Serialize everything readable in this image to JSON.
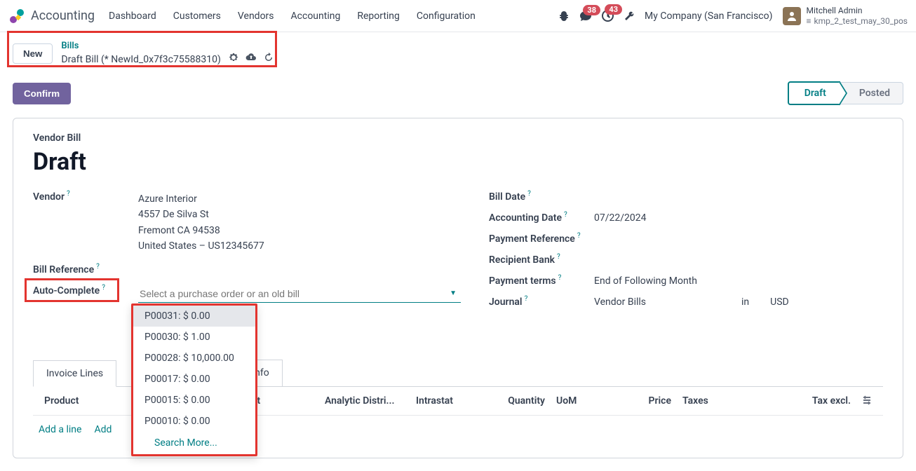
{
  "app_name": "Accounting",
  "menu": [
    "Dashboard",
    "Customers",
    "Vendors",
    "Accounting",
    "Reporting",
    "Configuration"
  ],
  "badges": {
    "messages": "38",
    "activities": "43"
  },
  "company": "My Company (San Francisco)",
  "user": {
    "name": "Mitchell Admin",
    "db": "kmp_2_test_may_30_pos"
  },
  "breadcrumb": {
    "parent": "Bills",
    "current": "Draft Bill (* NewId_0x7f3c75588310)"
  },
  "new_btn": "New",
  "confirm_btn": "Confirm",
  "status": {
    "draft": "Draft",
    "posted": "Posted"
  },
  "form": {
    "doc_type": "Vendor Bill",
    "state": "Draft",
    "vendor_label": "Vendor",
    "vendor_name": "Azure Interior",
    "vendor_addr1": "4557 De Silva St",
    "vendor_addr2": "Fremont CA 94538",
    "vendor_addr3": "United States – US12345677",
    "bill_ref_label": "Bill Reference",
    "auto_label": "Auto-Complete",
    "auto_placeholder": "Select a purchase order or an old bill",
    "bill_date_label": "Bill Date",
    "acc_date_label": "Accounting Date",
    "acc_date": "07/22/2024",
    "pay_ref_label": "Payment Reference",
    "recip_bank_label": "Recipient Bank",
    "pay_terms_label": "Payment terms",
    "pay_terms": "End of Following Month",
    "journal_label": "Journal",
    "journal": "Vendor Bills",
    "journal_in": "in",
    "journal_cur": "USD"
  },
  "dropdown": {
    "items": [
      "P00031: $ 0.00",
      "P00030: $ 1.00",
      "P00028: $ 10,000.00",
      "P00017: $ 0.00",
      "P00015: $ 0.00",
      "P00010: $ 0.00"
    ],
    "search": "Search More..."
  },
  "tabs": {
    "lines": "Invoice Lines",
    "other": "nfo"
  },
  "columns": {
    "product": "Product",
    "account": "ount",
    "analytic": "Analytic Distri...",
    "intra": "Intrastat",
    "qty": "Quantity",
    "uom": "UoM",
    "price": "Price",
    "tax": "Taxes",
    "excl": "Tax excl."
  },
  "add": {
    "line": "Add a line",
    "section": "Add "
  }
}
